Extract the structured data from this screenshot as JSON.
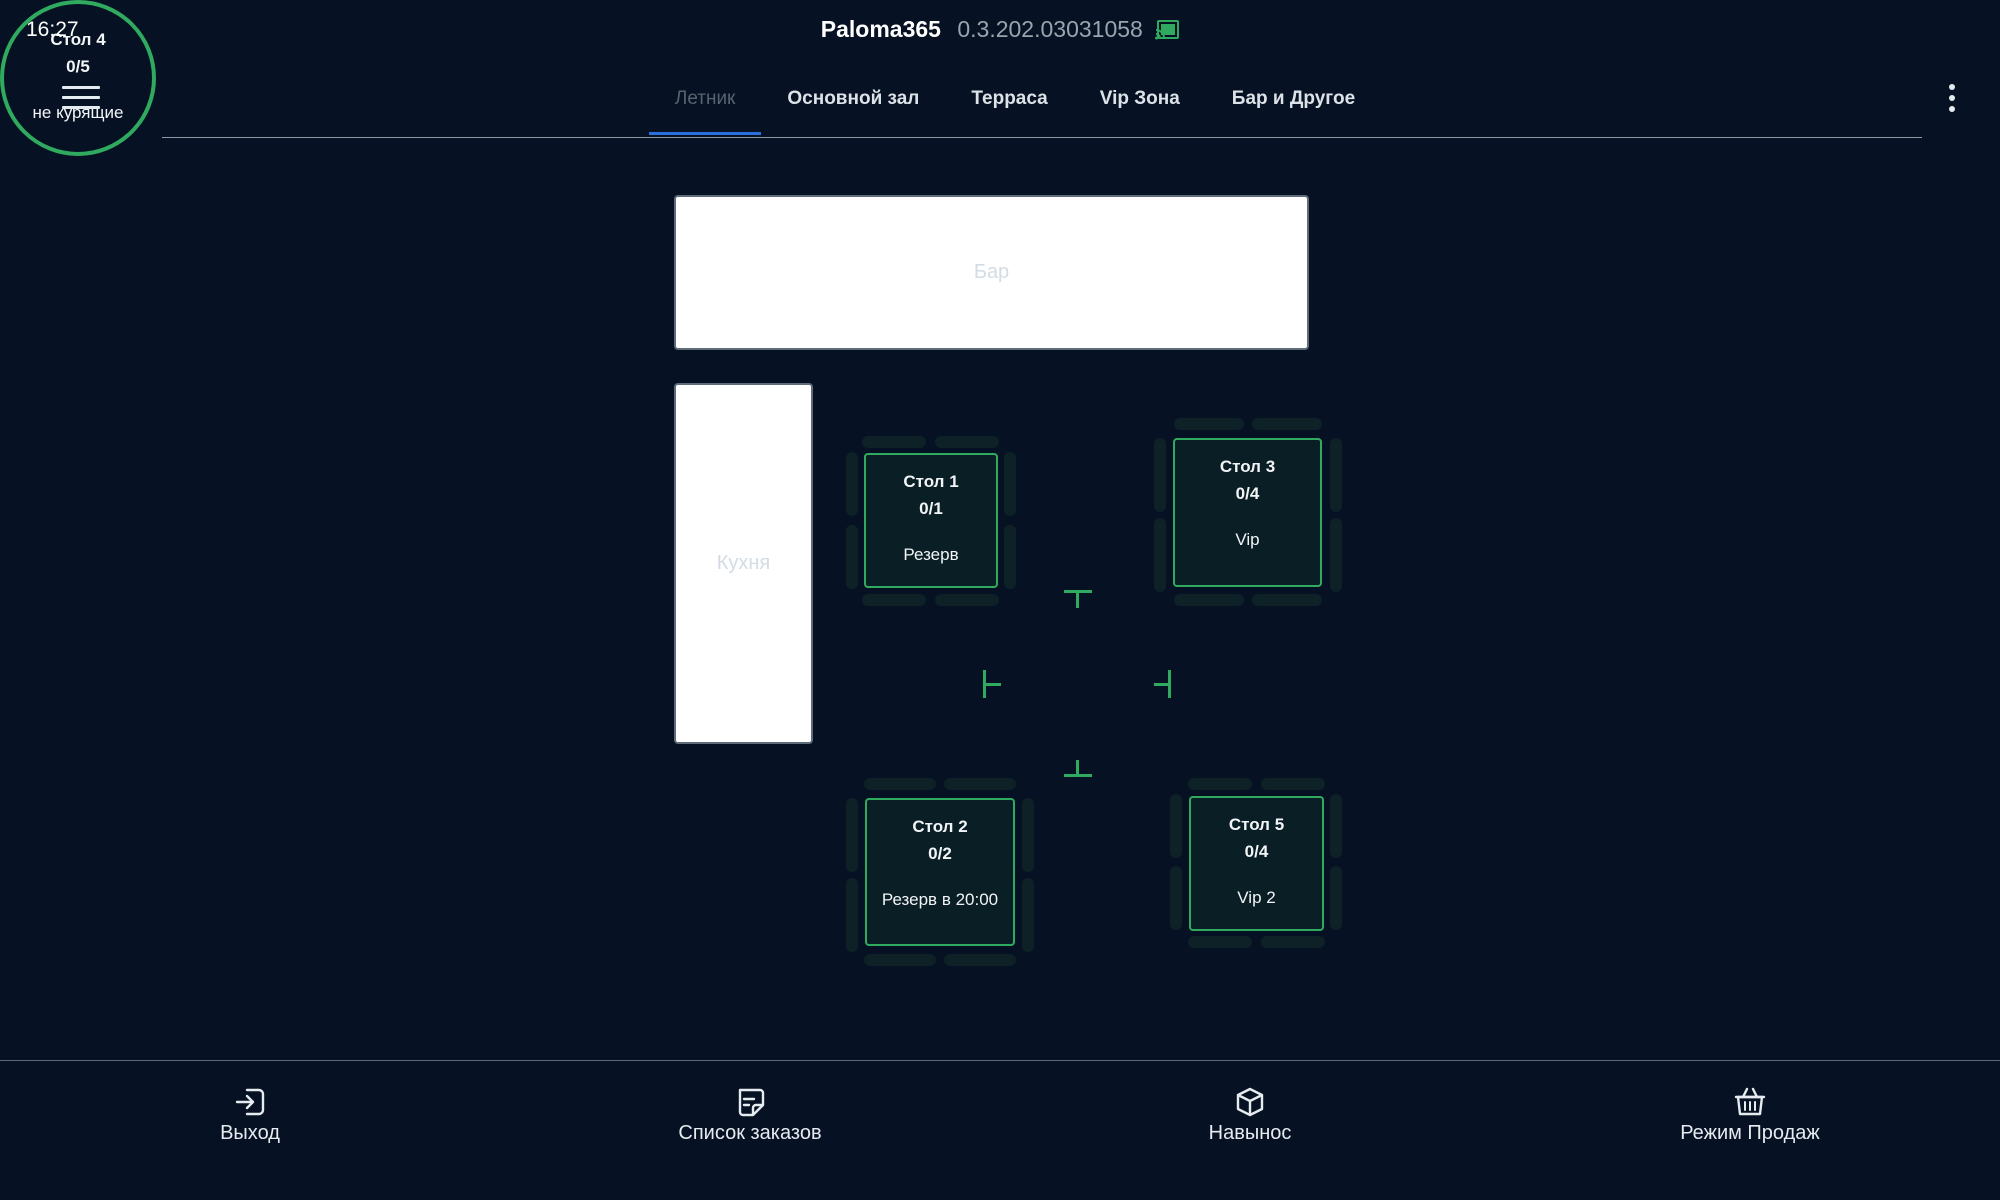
{
  "status_bar": {
    "time": "16:27"
  },
  "app": {
    "name": "Paloma365",
    "version": "0.3.202.03031058"
  },
  "tabs": [
    {
      "label": "Летник",
      "active": true
    },
    {
      "label": "Основной зал",
      "active": false
    },
    {
      "label": "Терраса",
      "active": false
    },
    {
      "label": "Vip Зона",
      "active": false
    },
    {
      "label": "Бар и Другое",
      "active": false
    }
  ],
  "zones": {
    "bar": "Бар",
    "kitchen": "Кухня"
  },
  "tables": [
    {
      "name": "Стол 1",
      "seats": "0/1",
      "note": "Резерв"
    },
    {
      "name": "Стол 2",
      "seats": "0/2",
      "note": "Резерв в 20:00"
    },
    {
      "name": "Стол 3",
      "seats": "0/4",
      "note": "Vip"
    },
    {
      "name": "Стол 4",
      "seats": "0/5",
      "note": "не курящие"
    },
    {
      "name": "Стол 5",
      "seats": "0/4",
      "note": "Vip 2"
    }
  ],
  "bottom_nav": {
    "exit": "Выход",
    "orders": "Список заказов",
    "takeaway": "Навынос",
    "sales_mode": "Режим Продаж"
  },
  "icons": {
    "cast": "cast-connected-icon",
    "menu": "hamburger-menu-icon",
    "more": "more-vertical-icon",
    "exit": "login-arrow-icon",
    "orders": "note-list-icon",
    "takeaway": "box-icon",
    "sales_mode": "basket-icon"
  },
  "colors": {
    "background": "#061223",
    "accent_green": "#2faa5e",
    "active_tab": "#2a6fdb"
  }
}
